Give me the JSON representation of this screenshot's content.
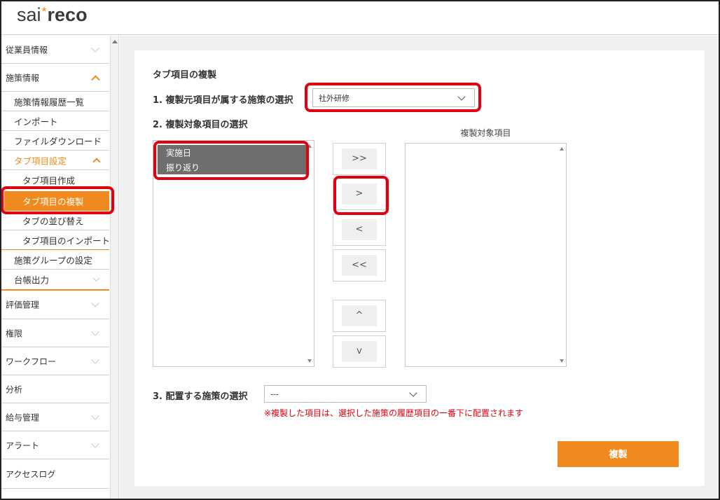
{
  "app": {
    "logo_part1": "sai",
    "logo_star": "*",
    "logo_part2": "reco"
  },
  "sidebar": {
    "employee_info": "従業員情報",
    "policy_info": "施策情報",
    "history_list": "施策情報履歴一覧",
    "import": "インポート",
    "file_download": "ファイルダウンロード",
    "tab_settings": "タブ項目設定",
    "tab_create": "タブ項目作成",
    "tab_copy": "タブ項目の複製",
    "tab_sort": "タブの並び替え",
    "tab_import": "タブ項目のインポート",
    "group_settings": "施策グループの設定",
    "ledger_output": "台帳出力",
    "evaluation": "評価管理",
    "permissions": "権限",
    "workflow": "ワークフロー",
    "analysis": "分析",
    "payroll": "給与管理",
    "alert": "アラート",
    "access_log": "アクセスログ"
  },
  "main": {
    "title": "タブ項目の複製",
    "step1_label": "1. 複製元項目が属する施策の選択",
    "step1_value": "社外研修",
    "step2_label": "2. 複製対象項目の選択",
    "source_items": [
      "実施日",
      "振り返り"
    ],
    "target_label": "複製対象項目",
    "btn_move_all_right": ">>",
    "btn_move_right": ">",
    "btn_move_left": "<",
    "btn_move_all_left": "<<",
    "btn_up": "^",
    "btn_down": "v",
    "step3_label": "3. 配置する施策の選択",
    "step3_value": "---",
    "note": "※複製した項目は、選択した施策の履歴項目の一番下に配置されます",
    "submit_label": "複製"
  },
  "colors": {
    "accent": "#f08a1e",
    "highlight": "#e0000f",
    "selected_option": "#6e6e6e"
  }
}
